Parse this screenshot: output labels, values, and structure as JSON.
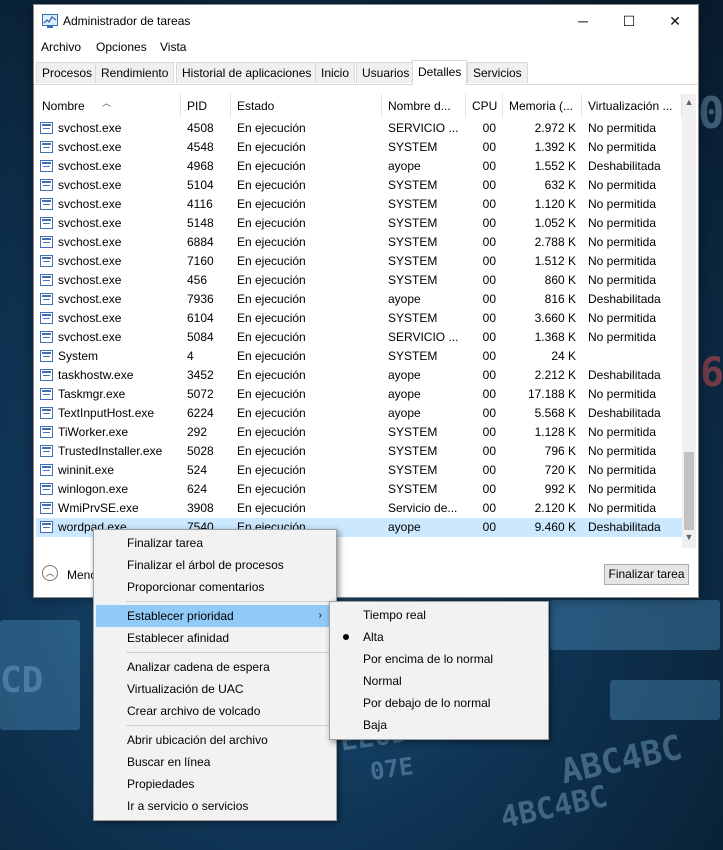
{
  "window": {
    "title": "Administrador de tareas",
    "controls": {
      "minimize": "─",
      "maximize": "☐",
      "close": "✕"
    }
  },
  "menubar": [
    "Archivo",
    "Opciones",
    "Vista"
  ],
  "tabs": [
    "Procesos",
    "Rendimiento",
    "Historial de aplicaciones",
    "Inicio",
    "Usuarios",
    "Detalles",
    "Servicios"
  ],
  "active_tab": "Detalles",
  "table": {
    "columns": [
      "Nombre",
      "PID",
      "Estado",
      "Nombre d...",
      "CPU",
      "Memoria (...",
      "Virtualización ..."
    ],
    "rows": [
      {
        "name": "svchost.exe",
        "pid": "4508",
        "status": "En ejecución",
        "user": "SERVICIO ...",
        "cpu": "00",
        "mem": "2.972 K",
        "virt": "No permitida"
      },
      {
        "name": "svchost.exe",
        "pid": "4548",
        "status": "En ejecución",
        "user": "SYSTEM",
        "cpu": "00",
        "mem": "1.392 K",
        "virt": "No permitida"
      },
      {
        "name": "svchost.exe",
        "pid": "4968",
        "status": "En ejecución",
        "user": "ayope",
        "cpu": "00",
        "mem": "1.552 K",
        "virt": "Deshabilitada"
      },
      {
        "name": "svchost.exe",
        "pid": "5104",
        "status": "En ejecución",
        "user": "SYSTEM",
        "cpu": "00",
        "mem": "632 K",
        "virt": "No permitida"
      },
      {
        "name": "svchost.exe",
        "pid": "4116",
        "status": "En ejecución",
        "user": "SYSTEM",
        "cpu": "00",
        "mem": "1.120 K",
        "virt": "No permitida"
      },
      {
        "name": "svchost.exe",
        "pid": "5148",
        "status": "En ejecución",
        "user": "SYSTEM",
        "cpu": "00",
        "mem": "1.052 K",
        "virt": "No permitida"
      },
      {
        "name": "svchost.exe",
        "pid": "6884",
        "status": "En ejecución",
        "user": "SYSTEM",
        "cpu": "00",
        "mem": "2.788 K",
        "virt": "No permitida"
      },
      {
        "name": "svchost.exe",
        "pid": "7160",
        "status": "En ejecución",
        "user": "SYSTEM",
        "cpu": "00",
        "mem": "1.512 K",
        "virt": "No permitida"
      },
      {
        "name": "svchost.exe",
        "pid": "456",
        "status": "En ejecución",
        "user": "SYSTEM",
        "cpu": "00",
        "mem": "860 K",
        "virt": "No permitida"
      },
      {
        "name": "svchost.exe",
        "pid": "7936",
        "status": "En ejecución",
        "user": "ayope",
        "cpu": "00",
        "mem": "816 K",
        "virt": "Deshabilitada"
      },
      {
        "name": "svchost.exe",
        "pid": "6104",
        "status": "En ejecución",
        "user": "SYSTEM",
        "cpu": "00",
        "mem": "3.660 K",
        "virt": "No permitida"
      },
      {
        "name": "svchost.exe",
        "pid": "5084",
        "status": "En ejecución",
        "user": "SERVICIO ...",
        "cpu": "00",
        "mem": "1.368 K",
        "virt": "No permitida"
      },
      {
        "name": "System",
        "pid": "4",
        "status": "En ejecución",
        "user": "SYSTEM",
        "cpu": "00",
        "mem": "24 K",
        "virt": ""
      },
      {
        "name": "taskhostw.exe",
        "pid": "3452",
        "status": "En ejecución",
        "user": "ayope",
        "cpu": "00",
        "mem": "2.212 K",
        "virt": "Deshabilitada"
      },
      {
        "name": "Taskmgr.exe",
        "pid": "5072",
        "status": "En ejecución",
        "user": "ayope",
        "cpu": "00",
        "mem": "17.188 K",
        "virt": "No permitida"
      },
      {
        "name": "TextInputHost.exe",
        "pid": "6224",
        "status": "En ejecución",
        "user": "ayope",
        "cpu": "00",
        "mem": "5.568 K",
        "virt": "Deshabilitada"
      },
      {
        "name": "TiWorker.exe",
        "pid": "292",
        "status": "En ejecución",
        "user": "SYSTEM",
        "cpu": "00",
        "mem": "1.128 K",
        "virt": "No permitida"
      },
      {
        "name": "TrustedInstaller.exe",
        "pid": "5028",
        "status": "En ejecución",
        "user": "SYSTEM",
        "cpu": "00",
        "mem": "796 K",
        "virt": "No permitida"
      },
      {
        "name": "wininit.exe",
        "pid": "524",
        "status": "En ejecución",
        "user": "SYSTEM",
        "cpu": "00",
        "mem": "720 K",
        "virt": "No permitida"
      },
      {
        "name": "winlogon.exe",
        "pid": "624",
        "status": "En ejecución",
        "user": "SYSTEM",
        "cpu": "00",
        "mem": "992 K",
        "virt": "No permitida"
      },
      {
        "name": "WmiPrvSE.exe",
        "pid": "3908",
        "status": "En ejecución",
        "user": "Servicio de...",
        "cpu": "00",
        "mem": "2.120 K",
        "virt": "No permitida"
      },
      {
        "name": "wordpad.exe",
        "pid": "7540",
        "status": "En ejecución",
        "user": "ayope",
        "cpu": "00",
        "mem": "9.460 K",
        "virt": "Deshabilitada",
        "selected": true
      }
    ]
  },
  "footer": {
    "less_details": "Menos detalles",
    "end_task": "Finalizar tarea"
  },
  "context_menu": {
    "items": [
      {
        "label": "Finalizar tarea"
      },
      {
        "label": "Finalizar el árbol de procesos"
      },
      {
        "label": "Proporcionar comentarios"
      },
      {
        "separator": true
      },
      {
        "label": "Establecer prioridad",
        "submenu": true,
        "highlighted": true
      },
      {
        "label": "Establecer afinidad"
      },
      {
        "separator": true
      },
      {
        "label": "Analizar cadena de espera"
      },
      {
        "label": "Virtualización de UAC"
      },
      {
        "label": "Crear archivo de volcado"
      },
      {
        "separator": true
      },
      {
        "label": "Abrir ubicación del archivo"
      },
      {
        "label": "Buscar en línea"
      },
      {
        "label": "Propiedades"
      },
      {
        "label": "Ir a servicio o servicios"
      }
    ]
  },
  "priority_submenu": {
    "items": [
      "Tiempo real",
      "Alta",
      "Por encima de lo normal",
      "Normal",
      "Por debajo de lo normal",
      "Baja"
    ],
    "checked": "Alta"
  },
  "colors": {
    "selection": "#cce8ff",
    "menu_highlight": "#91c9f7",
    "desktop": "#0f3555"
  }
}
